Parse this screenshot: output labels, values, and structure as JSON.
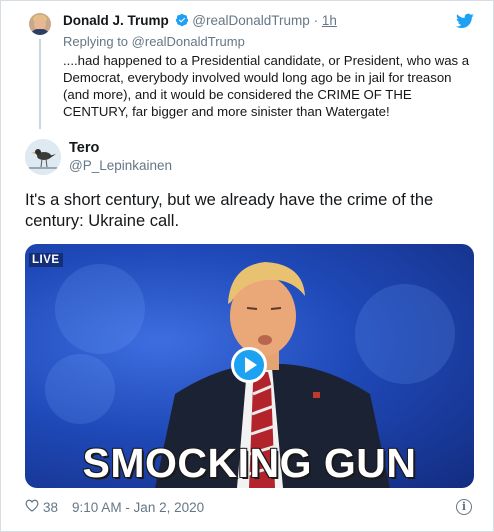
{
  "quoted_tweet": {
    "author_name": "Donald J. Trump",
    "handle": "@realDonaldTrump",
    "separator": "·",
    "time": "1h",
    "reply_prefix": "Replying to",
    "reply_handle": "@realDonaldTrump",
    "text": "....had happened to a Presidential candidate, or President, who was a Democrat, everybody involved would long ago be in jail for treason (and more), and it would be considered the CRIME OF THE CENTURY, far bigger and more sinister than Watergate!"
  },
  "main_tweet": {
    "author_name": "Tero",
    "handle": "@P_Lepinkainen",
    "text": "It's a short century, but we already have the crime of the century: Ukraine call.",
    "media": {
      "live_badge": "LIVE",
      "caption": "SMOCKING GUN"
    },
    "like_count": "38",
    "timestamp": "9:10 AM - Jan 2, 2020"
  },
  "icons": {
    "verified": "verified-badge-icon",
    "brand": "twitter-bird-icon",
    "like": "heart-icon",
    "info": "info-icon",
    "play": "play-icon"
  },
  "colors": {
    "accent": "#1da1f2",
    "secondary_text": "#657786",
    "primary_text": "#14171a"
  }
}
